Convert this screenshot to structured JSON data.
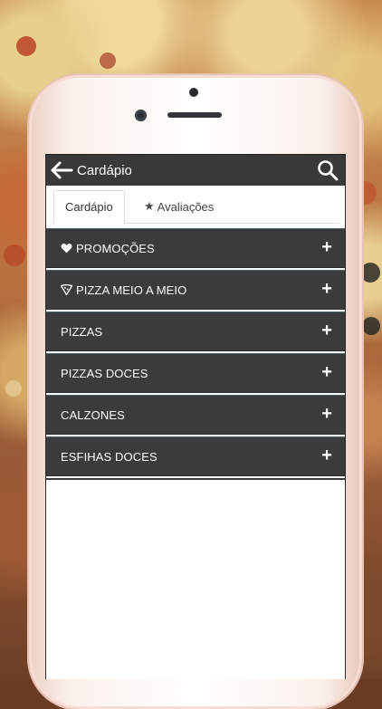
{
  "header": {
    "title": "Cardápio"
  },
  "tabs": [
    {
      "label": "Cardápio",
      "active": true
    },
    {
      "label": "Avaliações",
      "icon": "star-icon",
      "active": false
    }
  ],
  "menu": {
    "items": [
      {
        "label": "PROMOÇÕES",
        "icon": "heart-icon",
        "action_icon": "plus-icon"
      },
      {
        "label": "PIZZA MEIO A MEIO",
        "icon": "pizza-slice-icon",
        "action_icon": "plus-icon"
      },
      {
        "label": "PIZZAS",
        "action_icon": "plus-icon"
      },
      {
        "label": "PIZZAS DOCES",
        "action_icon": "plus-icon"
      },
      {
        "label": "CALZONES",
        "action_icon": "plus-icon"
      },
      {
        "label": "ESFIHAS DOCES",
        "action_icon": "plus-icon"
      }
    ],
    "plus_symbol": "+"
  },
  "colors": {
    "appbar": "#393939",
    "menu_item": "#3b3b3b",
    "menu_divider": "#51646a"
  }
}
